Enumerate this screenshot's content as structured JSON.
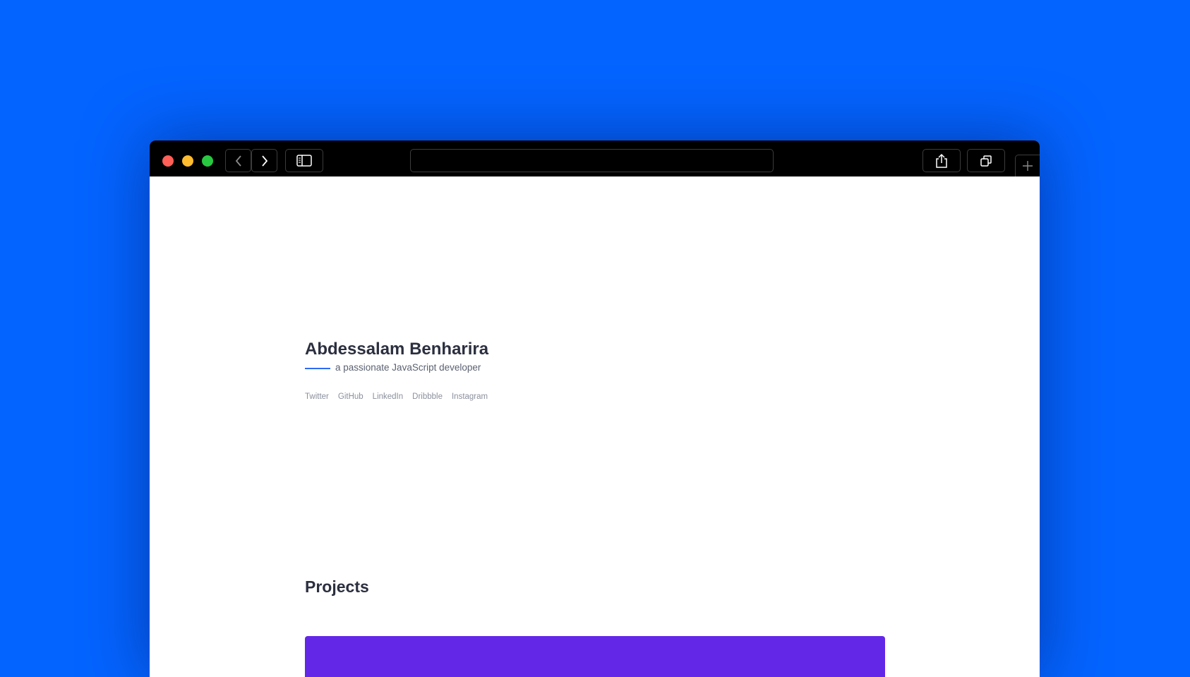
{
  "colors": {
    "background": "#0464ff",
    "accent": "#2e6bf2",
    "project_card": "#6327e8",
    "heading": "#2b2f3f"
  },
  "browser": {
    "icons": {
      "close": "close-dot",
      "minimize": "minimize-dot",
      "zoom": "zoom-dot",
      "back": "chevron-left-icon",
      "forward": "chevron-right-icon",
      "sidebar": "sidebar-icon",
      "share": "share-icon",
      "tabs": "tabs-icon",
      "new_tab": "plus-icon"
    },
    "address_value": ""
  },
  "profile": {
    "name": "Abdessalam Benharira",
    "tagline": "a passionate JavaScript developer"
  },
  "social_links": [
    "Twitter",
    "GitHub",
    "LinkedIn",
    "Dribbble",
    "Instagram"
  ],
  "projects": {
    "heading": "Projects"
  }
}
